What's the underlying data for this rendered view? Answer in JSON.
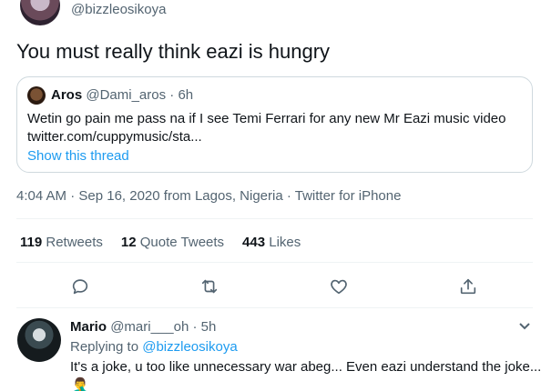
{
  "tweet": {
    "handle": "@bizzleosikoya",
    "text": "You must really think eazi is hungry",
    "timestamp": "4:04 AM · Sep 16, 2020 from Lagos, Nigeria · Twitter for iPhone"
  },
  "quote": {
    "name": "Aros",
    "handle_time": "@Dami_aros · 6h",
    "line1": "Wetin go pain me pass na if I see Temi Ferrari for any new Mr Eazi music video",
    "line2": "twitter.com/cuppymusic/sta...",
    "show_thread": "Show this thread"
  },
  "stats": {
    "retweets_count": "119",
    "retweets_label": "Retweets",
    "quotes_count": "12",
    "quotes_label": "Quote Tweets",
    "likes_count": "443",
    "likes_label": "Likes"
  },
  "actions": {
    "icons": [
      "reply-icon",
      "retweet-icon",
      "like-icon",
      "share-icon"
    ]
  },
  "reply": {
    "name": "Mario",
    "handle_time": "@mari___oh · 5h",
    "replying_prefix": "Replying to",
    "replying_to": "@bizzleosikoya",
    "text": "It's a joke, u too like unnecessary war abeg... Even eazi understand the joke...",
    "emoji": "🤦‍♂️"
  },
  "colors": {
    "link": "#1d9bf0",
    "secondary_text": "#536471",
    "border": "#cfd9de"
  }
}
